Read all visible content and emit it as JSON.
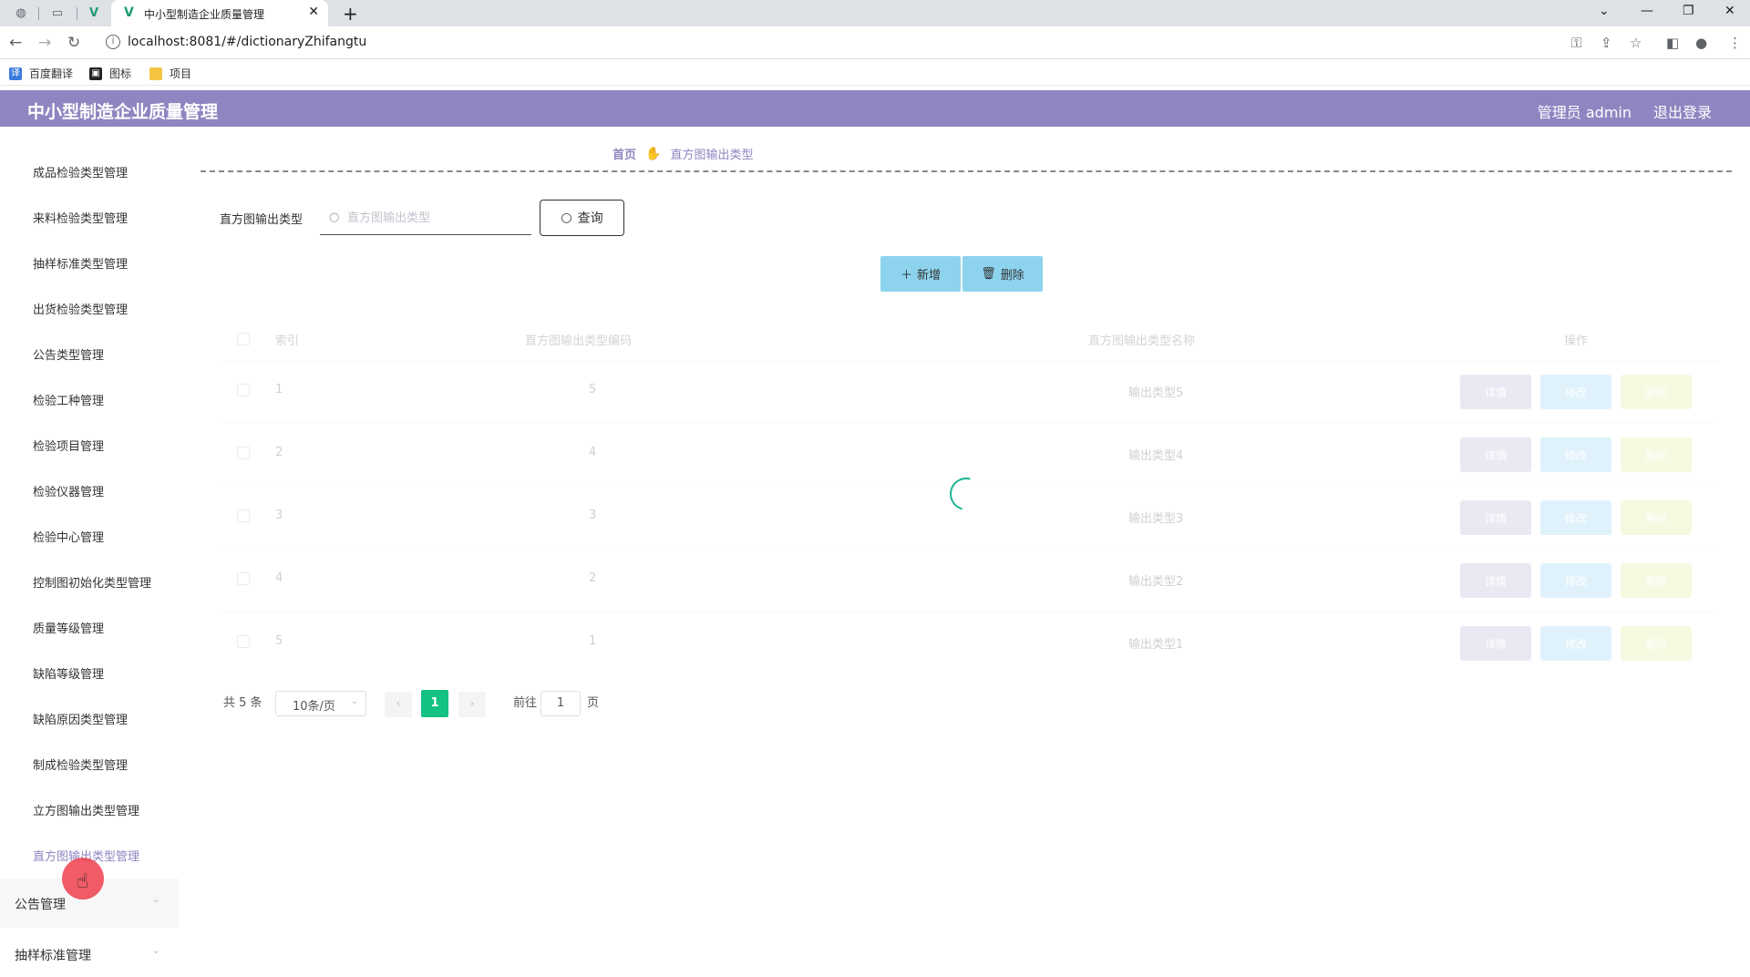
{
  "browser": {
    "tab_title": "中小型制造企业质量管理",
    "url": "localhost:8081/#/dictionaryZhifangtu",
    "bookmarks": [
      {
        "label": "百度翻译",
        "icon": "translate-icon",
        "color": "#3a7be0"
      },
      {
        "label": "图标",
        "icon": "image-icon",
        "color": "#222222"
      },
      {
        "label": "项目",
        "icon": "folder-icon",
        "color": "#f5c542"
      }
    ]
  },
  "header": {
    "title": "中小型制造企业质量管理",
    "admin": "管理员 admin",
    "logout": "退出登录",
    "color": "#8e86c1"
  },
  "sidebar": {
    "items": [
      {
        "label": "成品检验类型管理"
      },
      {
        "label": "来料检验类型管理"
      },
      {
        "label": "抽样标准类型管理"
      },
      {
        "label": "出货检验类型管理"
      },
      {
        "label": "公告类型管理"
      },
      {
        "label": "检验工种管理"
      },
      {
        "label": "检验项目管理"
      },
      {
        "label": "检验仪器管理"
      },
      {
        "label": "检验中心管理"
      },
      {
        "label": "控制图初始化类型管理"
      },
      {
        "label": "质量等级管理"
      },
      {
        "label": "缺陷等级管理"
      },
      {
        "label": "缺陷原因类型管理"
      },
      {
        "label": "制成检验类型管理"
      },
      {
        "label": "立方图输出类型管理"
      },
      {
        "label": "直方图输出类型管理",
        "active": true
      }
    ],
    "groups": [
      {
        "label": "公告管理"
      },
      {
        "label": "抽样标准管理"
      }
    ]
  },
  "breadcrumb": {
    "home": "首页",
    "current": "直方图输出类型"
  },
  "search": {
    "label": "直方图输出类型",
    "placeholder": "直方图输出类型",
    "value": "",
    "button": "查询"
  },
  "actions": {
    "add": "新增",
    "delete": "删除"
  },
  "table": {
    "headers": [
      "索引",
      "直方图输出类型编码",
      "直方图输出类型名称",
      "操作"
    ],
    "rows": [
      {
        "index": "1",
        "code": "5",
        "name": "输出类型5"
      },
      {
        "index": "2",
        "code": "4",
        "name": "输出类型4"
      },
      {
        "index": "3",
        "code": "3",
        "name": "输出类型3"
      },
      {
        "index": "4",
        "code": "2",
        "name": "输出类型2"
      },
      {
        "index": "5",
        "code": "1",
        "name": "输出类型1"
      }
    ],
    "row_actions": {
      "detail": "详情",
      "edit": "修改",
      "remove": "删除"
    },
    "loading": true
  },
  "pagination": {
    "total": "共 5 条",
    "page_size": "10条/页",
    "current": "1",
    "goto_label": "前往",
    "goto_value": "1",
    "page_unit": "页"
  }
}
